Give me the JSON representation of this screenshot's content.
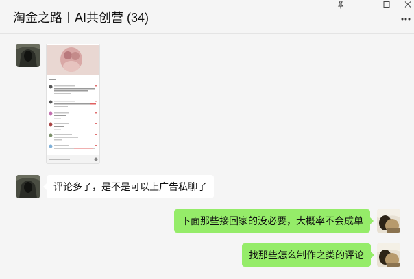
{
  "window": {
    "title": "淘金之路丨AI共创营 (34)",
    "pin_icon": "pin-icon",
    "minimize_icon": "minimize-icon",
    "maximize_icon": "maximize-icon",
    "close_icon": "close-icon",
    "more_icon": "more-icon"
  },
  "messages": [
    {
      "side": "left",
      "type": "image",
      "avatar": "hooded-figure-avatar"
    },
    {
      "side": "left",
      "type": "text",
      "text": "评论多了，是不是可以上广告私聊了",
      "avatar": "hooded-figure-avatar"
    },
    {
      "side": "right",
      "type": "text",
      "text": "下面那些接回家的没必要，大概率不会成单",
      "avatar": "self-avatar"
    },
    {
      "side": "right",
      "type": "text",
      "text": "找那些怎么制作之类的评论",
      "avatar": "self-avatar"
    }
  ],
  "colors": {
    "background": "#f5f5f5",
    "bubble_self": "#95ec69",
    "bubble_other": "#ffffff"
  }
}
